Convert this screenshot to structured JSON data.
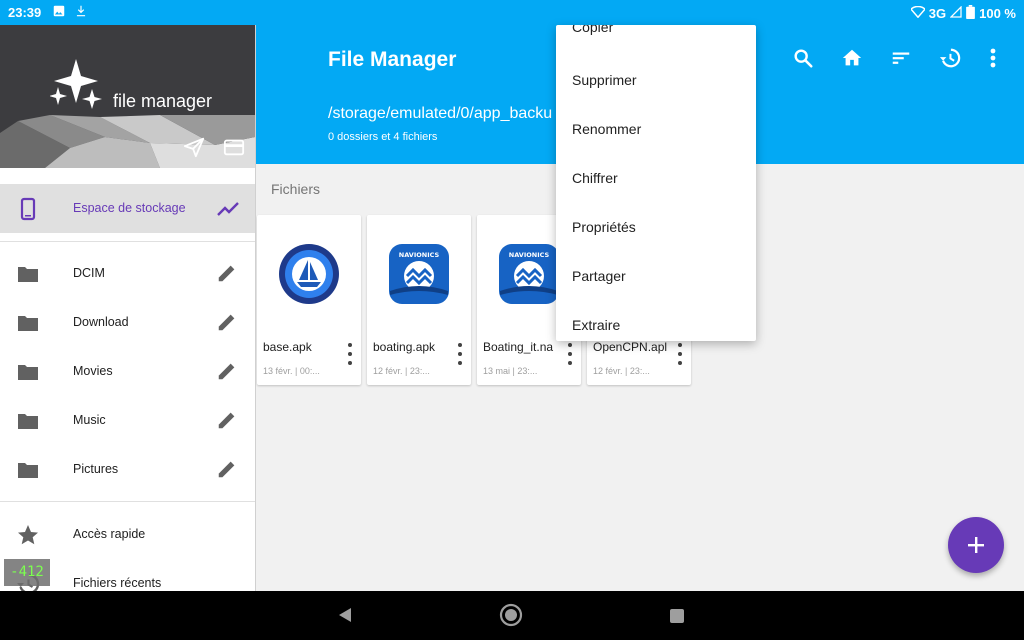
{
  "status_bar": {
    "time": "23:39",
    "network": "3G",
    "battery": "100 %"
  },
  "app_bar": {
    "title": "File Manager",
    "path": "/storage/emulated/0/app_backu",
    "counts": "0 dossiers et 4 fichiers",
    "actions": [
      "search-icon",
      "home-icon",
      "sort-icon",
      "history-icon",
      "more-vert-icon"
    ]
  },
  "drawer": {
    "brand": "file manager",
    "storage_label": "Espace de stockage",
    "folders": [
      {
        "label": "DCIM"
      },
      {
        "label": "Download"
      },
      {
        "label": "Movies"
      },
      {
        "label": "Music"
      },
      {
        "label": "Pictures"
      }
    ],
    "quick_access": "Accès rapide",
    "recent_files": "Fichiers récents"
  },
  "content": {
    "section_label": "Fichiers",
    "files": [
      {
        "name": "base.apk",
        "meta": "13 févr. | 00:..."
      },
      {
        "name": "boating.apk",
        "meta": "12 févr. | 23:..."
      },
      {
        "name": "Boating_it.na",
        "meta": "13 mai | 23:..."
      },
      {
        "name": "OpenCPN.apl",
        "meta": "12 févr. | 23:..."
      }
    ]
  },
  "context_menu": {
    "items": [
      "Copier",
      "Supprimer",
      "Renommer",
      "Chiffrer",
      "Propriétés",
      "Partager",
      "Extraire"
    ]
  },
  "debug_overlay": "-412",
  "colors": {
    "primary": "#03a9f4",
    "accent": "#673ab7",
    "drawer_header": "#3c3c3f",
    "selected_tint": "#673ab7"
  }
}
